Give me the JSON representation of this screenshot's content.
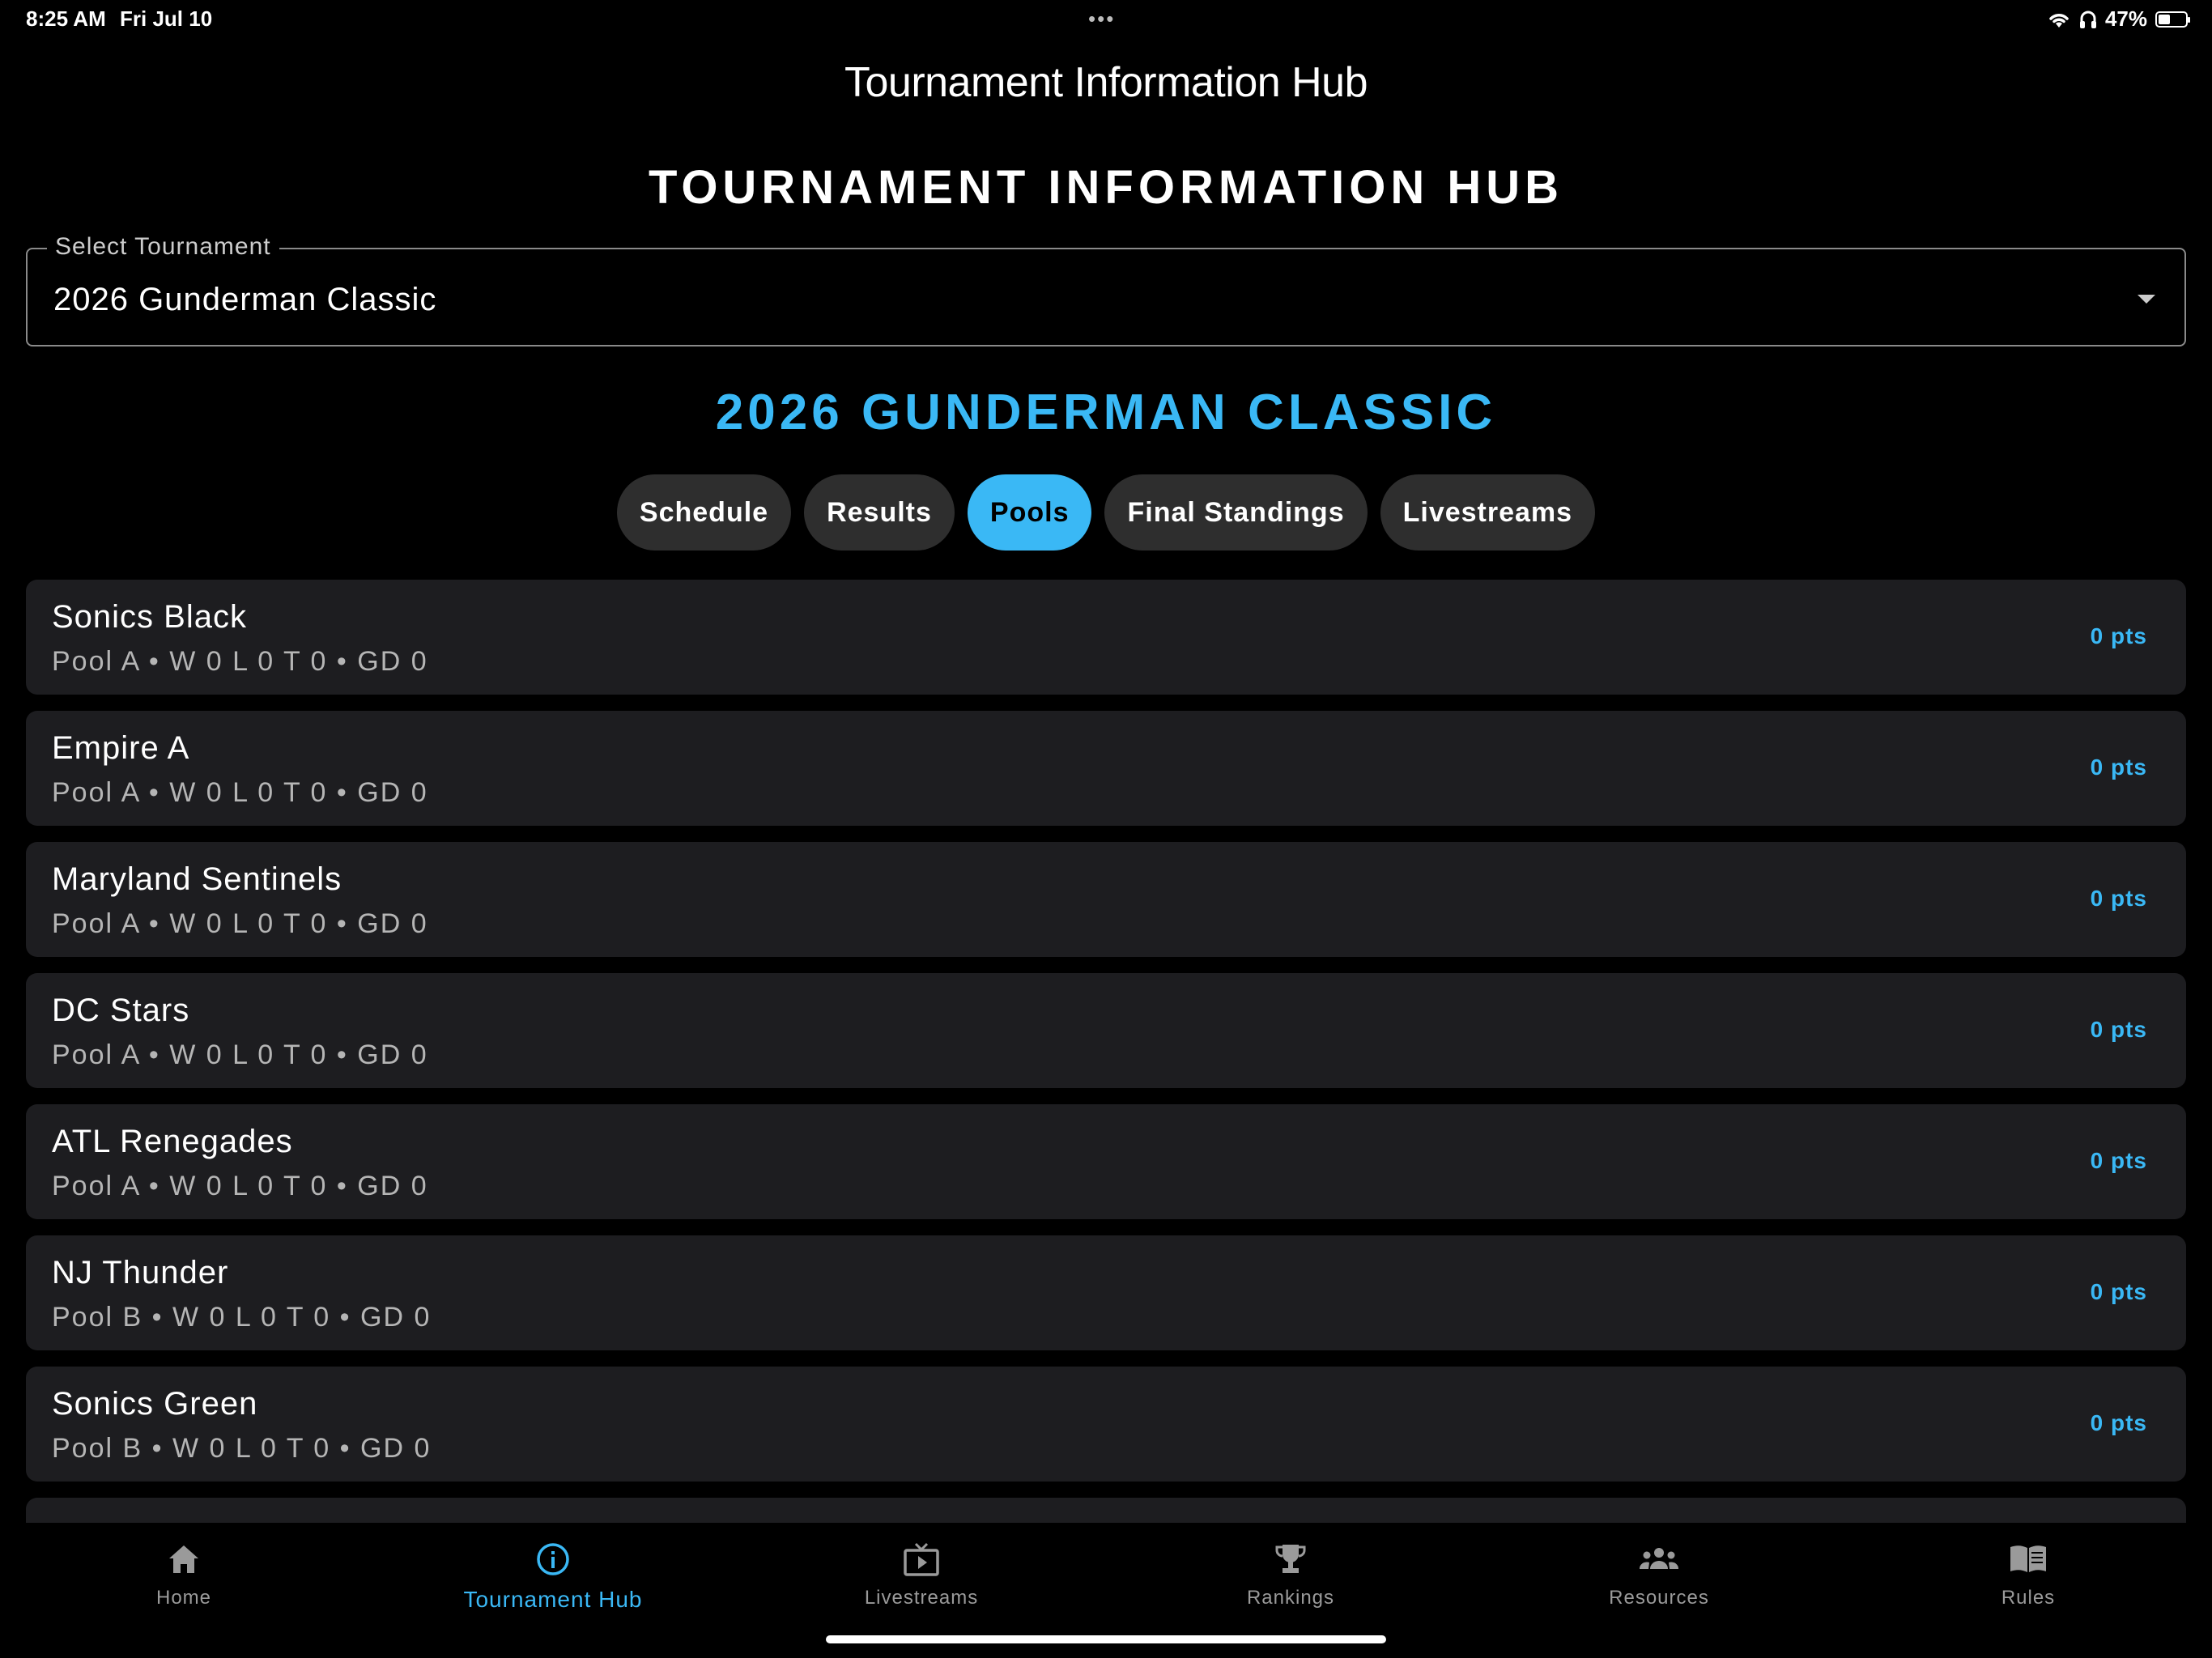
{
  "status_bar": {
    "time": "8:25 AM",
    "date": "Fri Jul 10",
    "dots": "•••",
    "battery": "47%"
  },
  "nav": {
    "title": "Tournament Information Hub"
  },
  "hub_heading": "TOURNAMENT INFORMATION HUB",
  "select": {
    "label": "Select Tournament",
    "value": "2026 Gunderman Classic"
  },
  "event_title": "2026 GUNDERMAN CLASSIC",
  "tabs": [
    {
      "label": "Schedule",
      "active": false
    },
    {
      "label": "Results",
      "active": false
    },
    {
      "label": "Pools",
      "active": true
    },
    {
      "label": "Final Standings",
      "active": false
    },
    {
      "label": "Livestreams",
      "active": false
    }
  ],
  "teams": [
    {
      "name": "Sonics Black",
      "meta": "Pool A • W 0 L 0 T 0 • GD 0",
      "pts": "0 pts"
    },
    {
      "name": "Empire A",
      "meta": "Pool A • W 0 L 0 T 0 • GD 0",
      "pts": "0 pts"
    },
    {
      "name": "Maryland Sentinels",
      "meta": "Pool A • W 0 L 0 T 0 • GD 0",
      "pts": "0 pts"
    },
    {
      "name": "DC Stars",
      "meta": "Pool A • W 0 L 0 T 0 • GD 0",
      "pts": "0 pts"
    },
    {
      "name": "ATL Renegades",
      "meta": "Pool A • W 0 L 0 T 0 • GD 0",
      "pts": "0 pts"
    },
    {
      "name": "NJ Thunder",
      "meta": "Pool B • W 0 L 0 T 0 • GD 0",
      "pts": "0 pts"
    },
    {
      "name": "Sonics Green",
      "meta": "Pool B • W 0 L 0 T 0 • GD 0",
      "pts": "0 pts"
    }
  ],
  "tabbar": [
    {
      "label": "Home",
      "icon": "home-icon",
      "active": false
    },
    {
      "label": "Tournament Hub",
      "icon": "info-icon",
      "active": true
    },
    {
      "label": "Livestreams",
      "icon": "tv-icon",
      "active": false
    },
    {
      "label": "Rankings",
      "icon": "trophy-icon",
      "active": false
    },
    {
      "label": "Resources",
      "icon": "people-icon",
      "active": false
    },
    {
      "label": "Rules",
      "icon": "book-icon",
      "active": false
    }
  ],
  "colors": {
    "accent": "#3ab8f5",
    "background": "#000000",
    "card": "#1d1d20",
    "pill": "#2e2e2e"
  }
}
